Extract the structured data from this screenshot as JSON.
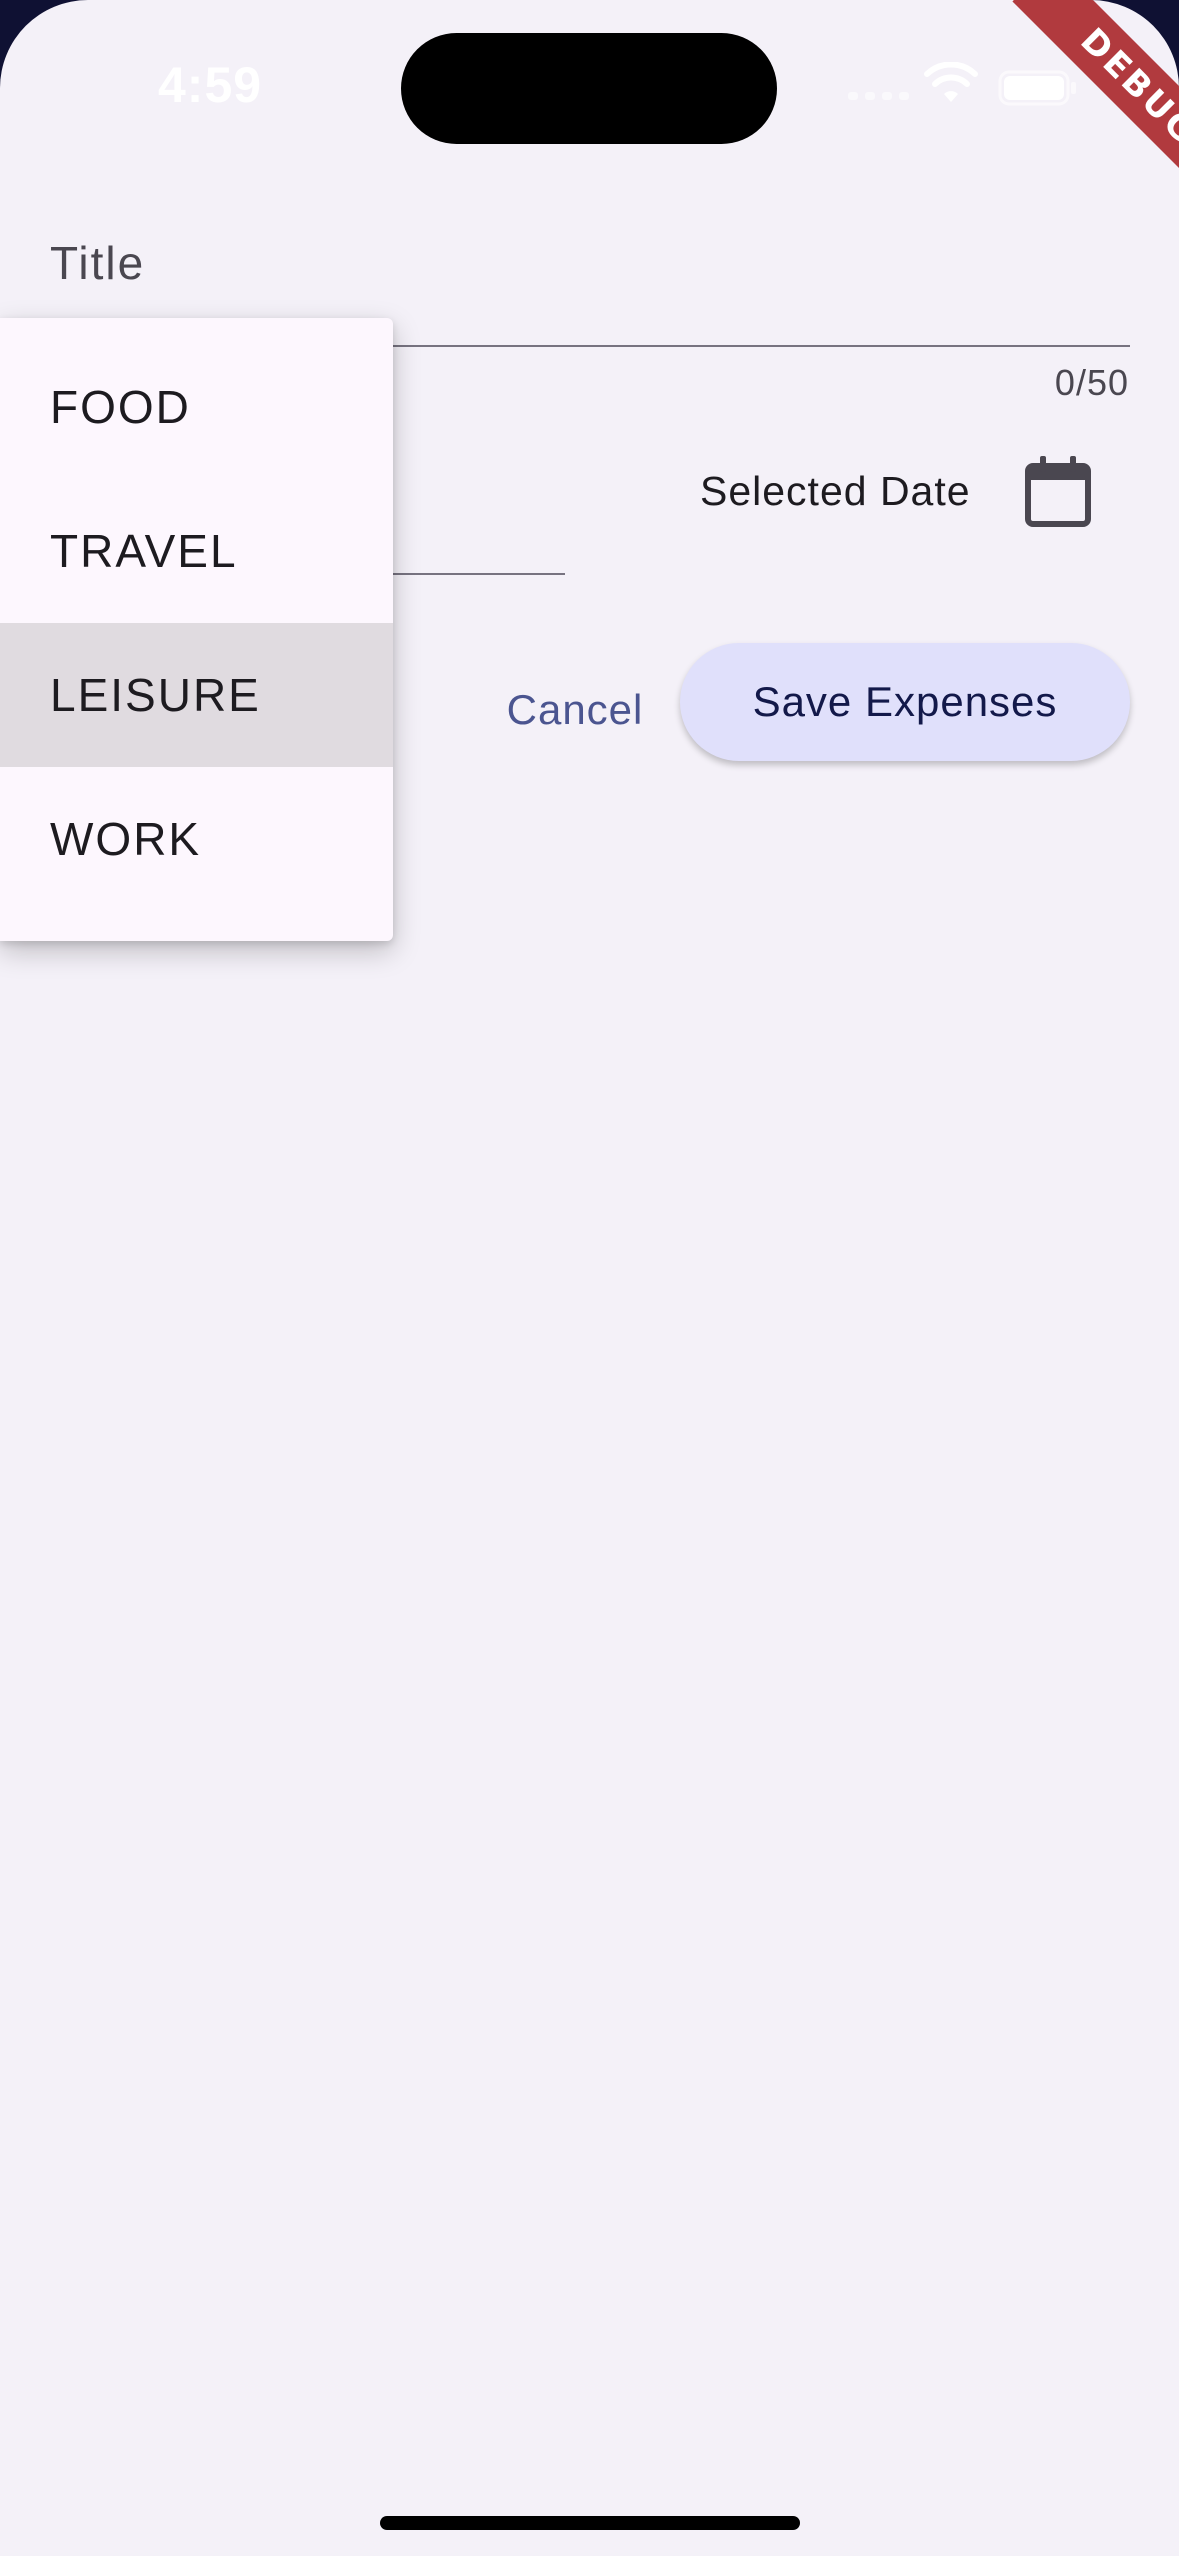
{
  "status_bar": {
    "time": "4:59"
  },
  "debug_banner": "DEBUG",
  "form": {
    "title_label": "Title",
    "title_counter": "0/50",
    "selected_date_label": "Selected Date",
    "cancel_label": "Cancel",
    "save_label": "Save Expenses"
  },
  "dropdown": {
    "items": [
      "FOOD",
      "TRAVEL",
      "LEISURE",
      "WORK"
    ],
    "highlighted": "LEISURE"
  },
  "icons": {
    "calendar": "calendar-icon",
    "wifi": "wifi-icon",
    "battery": "battery-icon",
    "signal": "cellular-signal-icon"
  },
  "colors": {
    "background": "#f4f1f8",
    "primary_button_bg": "#e0e0fb",
    "primary_button_text": "#13194a",
    "text_button": "#4b5590",
    "menu_bg": "#fdf7fe",
    "menu_highlight": "#e0dbe0",
    "debug_ribbon": "#b13a3e"
  }
}
